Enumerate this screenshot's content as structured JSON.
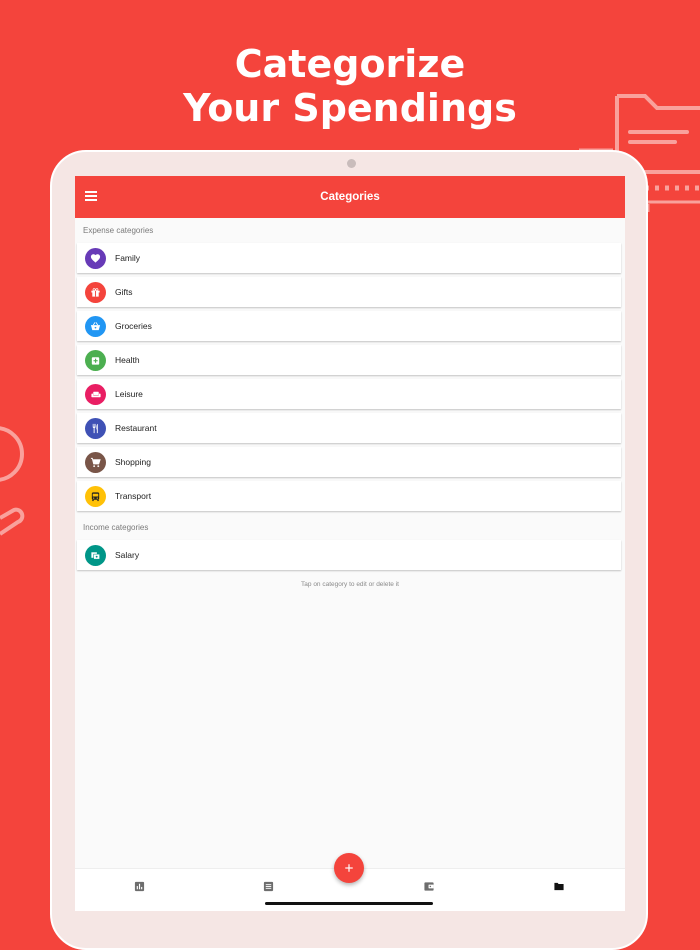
{
  "headline": {
    "line1": "Categorize",
    "line2": "Your Spendings"
  },
  "colors": {
    "background": "#f4443c",
    "accent": "#f4443c"
  },
  "app": {
    "title": "Categories",
    "menu_icon": "hamburger-menu-icon"
  },
  "expense": {
    "header": "Expense categories",
    "items": [
      {
        "label": "Family",
        "color": "#673ab7",
        "icon": "heart-icon"
      },
      {
        "label": "Gifts",
        "color": "#f4443c",
        "icon": "gift-icon"
      },
      {
        "label": "Groceries",
        "color": "#2196f3",
        "icon": "basket-icon"
      },
      {
        "label": "Health",
        "color": "#4caf50",
        "icon": "medical-kit-icon"
      },
      {
        "label": "Leisure",
        "color": "#e91e63",
        "icon": "couch-icon"
      },
      {
        "label": "Restaurant",
        "color": "#3f51b5",
        "icon": "fork-knife-icon"
      },
      {
        "label": "Shopping",
        "color": "#795548",
        "icon": "cart-icon"
      },
      {
        "label": "Transport",
        "color": "#ffc107",
        "icon": "bus-icon"
      }
    ]
  },
  "income": {
    "header": "Income categories",
    "items": [
      {
        "label": "Salary",
        "color": "#009688",
        "icon": "money-icon"
      }
    ]
  },
  "hint": "Tap on category to edit or delete it",
  "bottom_nav": [
    {
      "name": "nav-charts",
      "icon": "bar-chart-icon"
    },
    {
      "name": "nav-records",
      "icon": "list-icon"
    },
    {
      "name": "nav-accounts",
      "icon": "wallet-icon"
    },
    {
      "name": "nav-categories",
      "icon": "folder-icon"
    }
  ],
  "fab": {
    "icon": "plus-icon"
  }
}
